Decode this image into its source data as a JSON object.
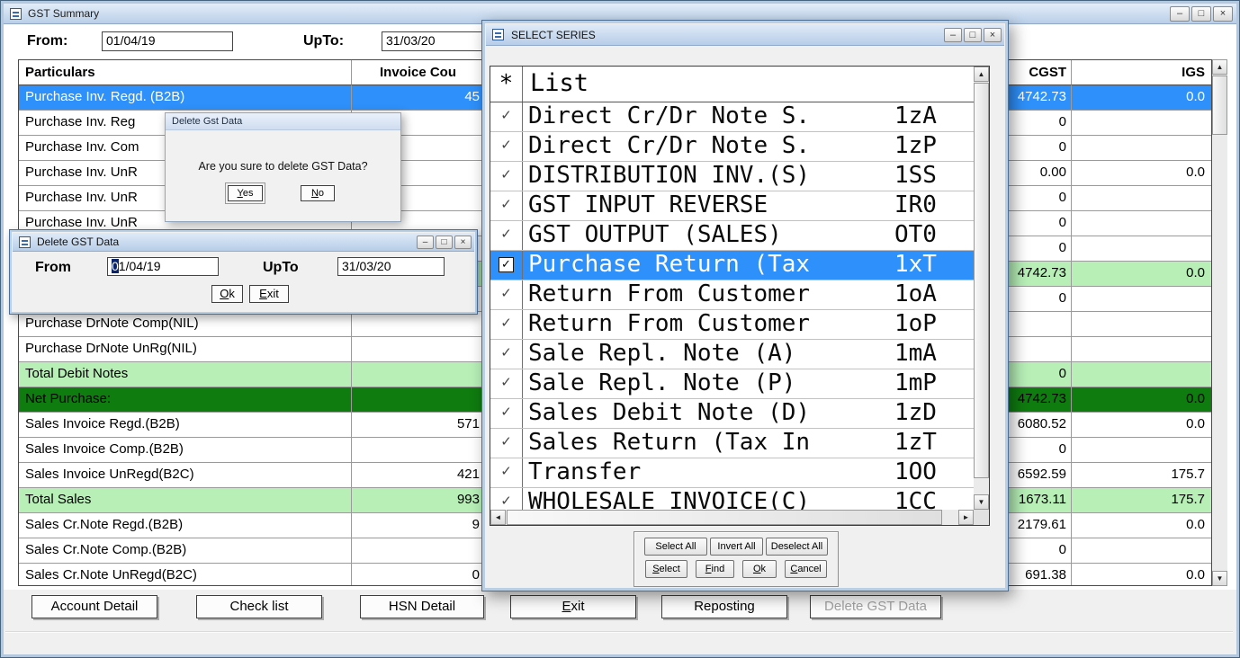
{
  "icons": {
    "scroll_up": "▲",
    "scroll_down": "▼",
    "scroll_left": "◄",
    "scroll_right": "►",
    "check": "✓"
  },
  "colors": {
    "selected_row": "#2e90fa",
    "total_row": "#b7efb7",
    "net_row": "#0f7c0f",
    "titlebar": "#b9cfe8",
    "selection_block": "#0a246a"
  },
  "main_window": {
    "title": "GST Summary",
    "controls": {
      "minimize": "–",
      "maximize": "□",
      "close": "×"
    },
    "filter": {
      "from_label": "From:",
      "from_value": "01/04/19",
      "upto_label": "UpTo:",
      "upto_value": "31/03/20"
    },
    "table": {
      "headers": {
        "particulars": "Particulars",
        "invoice_count": "Invoice Cou",
        "cgst": "CGST",
        "igst": "IGS"
      },
      "rows": [
        {
          "name": "Purchase Inv. Regd. (B2B)",
          "count": "45",
          "cgst": "4742.73",
          "igst": "0.0",
          "style": "selected"
        },
        {
          "name": "Purchase Inv. Reg",
          "count": "",
          "cgst": "0",
          "igst": "",
          "style": "normal"
        },
        {
          "name": "Purchase Inv. Com",
          "count": "",
          "cgst": "0",
          "igst": "",
          "style": "normal"
        },
        {
          "name": "Purchase Inv. UnR",
          "count": "",
          "cgst": "0.00",
          "igst": "0.0",
          "style": "normal"
        },
        {
          "name": "Purchase Inv. UnR",
          "count": "",
          "cgst": "0",
          "igst": "",
          "style": "normal"
        },
        {
          "name": "Purchase Inv. UnR",
          "count": "",
          "cgst": "0",
          "igst": "",
          "style": "normal"
        },
        {
          "name": "",
          "count": "",
          "cgst": "0",
          "igst": "",
          "style": "normal"
        },
        {
          "name": "",
          "count": "",
          "cgst": "4742.73",
          "igst": "0.0",
          "style": "total"
        },
        {
          "name": "",
          "count": "",
          "cgst": "0",
          "igst": "",
          "style": "normal"
        },
        {
          "name": "Purchase DrNote Comp(NIL)",
          "count": "",
          "cgst": "",
          "igst": "",
          "style": "normal"
        },
        {
          "name": "Purchase DrNote UnRg(NIL)",
          "count": "",
          "cgst": "",
          "igst": "",
          "style": "normal"
        },
        {
          "name": "Total Debit Notes",
          "count": "",
          "cgst": "0",
          "igst": "",
          "style": "total"
        },
        {
          "name": "Net Purchase:",
          "count": "",
          "cgst": "4742.73",
          "igst": "0.0",
          "style": "net"
        },
        {
          "name": "Sales Invoice Regd.(B2B)",
          "count": "571",
          "cgst": "6080.52",
          "igst": "0.0",
          "style": "normal"
        },
        {
          "name": "Sales Invoice Comp.(B2B)",
          "count": "",
          "cgst": "0",
          "igst": "",
          "style": "normal"
        },
        {
          "name": "Sales Invoice UnRegd(B2C)",
          "count": "421",
          "cgst": "6592.59",
          "igst": "175.7",
          "style": "normal"
        },
        {
          "name": "Total Sales",
          "count": "993",
          "cgst": "1673.11",
          "igst": "175.7",
          "style": "total"
        },
        {
          "name": "Sales Cr.Note Regd.(B2B)",
          "count": "9",
          "cgst": "2179.61",
          "igst": "0.0",
          "style": "normal"
        },
        {
          "name": "Sales Cr.Note Comp.(B2B)",
          "count": "",
          "cgst": "0",
          "igst": "",
          "style": "normal"
        },
        {
          "name": "Sales Cr.Note UnRegd(B2C)",
          "count": "0",
          "cgst": "691.38",
          "igst": "0.0",
          "style": "normal"
        }
      ]
    },
    "footer_buttons": [
      {
        "label": "Account Detail",
        "disabled": false,
        "mn": false
      },
      {
        "label": "Check list",
        "disabled": false,
        "mn": false
      },
      {
        "label": "HSN Detail",
        "disabled": false,
        "mn": false
      },
      {
        "label": "Exit",
        "disabled": false,
        "mn": true
      },
      {
        "label": "Reposting",
        "disabled": false,
        "mn": false
      },
      {
        "label": "Delete GST Data",
        "disabled": true,
        "mn": false
      }
    ]
  },
  "confirm_dialog": {
    "title": "Delete Gst Data",
    "message": "Are you sure to delete GST Data?",
    "yes_label": "Yes",
    "no_label": "No"
  },
  "delete_dialog": {
    "title": "Delete GST Data",
    "controls": {
      "minimize": "–",
      "maximize": "□",
      "close": "×"
    },
    "from_label": "From",
    "from_value": "01/04/19",
    "upto_label": "UpTo",
    "upto_value": "31/03/20",
    "ok_label": "Ok",
    "exit_label": "Exit"
  },
  "select_series": {
    "title": "SELECT SERIES",
    "controls": {
      "minimize": "–",
      "maximize": "□",
      "close": "×"
    },
    "header": {
      "star": "*",
      "list": "List"
    },
    "items": [
      {
        "name": "Direct Cr/Dr Note S.",
        "code": "1zA",
        "checked": true,
        "selected": false
      },
      {
        "name": "Direct Cr/Dr Note S.",
        "code": "1zP",
        "checked": true,
        "selected": false
      },
      {
        "name": "DISTRIBUTION INV.(S)",
        "code": "1SS",
        "checked": true,
        "selected": false
      },
      {
        "name": "GST INPUT REVERSE",
        "code": "IR0",
        "checked": true,
        "selected": false
      },
      {
        "name": "GST OUTPUT (SALES)",
        "code": "OT0",
        "checked": true,
        "selected": false
      },
      {
        "name": "Purchase Return (Tax",
        "code": "1xT",
        "checked": true,
        "selected": true
      },
      {
        "name": "Return From Customer",
        "code": "1oA",
        "checked": true,
        "selected": false
      },
      {
        "name": "Return From Customer",
        "code": "1oP",
        "checked": true,
        "selected": false
      },
      {
        "name": "Sale Repl. Note (A)",
        "code": "1mA",
        "checked": true,
        "selected": false
      },
      {
        "name": "Sale Repl. Note (P)",
        "code": "1mP",
        "checked": true,
        "selected": false
      },
      {
        "name": "Sales Debit Note (D)",
        "code": "1zD",
        "checked": true,
        "selected": false
      },
      {
        "name": "Sales Return (Tax In",
        "code": "1zT",
        "checked": true,
        "selected": false
      },
      {
        "name": "Transfer",
        "code": "1OO",
        "checked": true,
        "selected": false
      },
      {
        "name": "WHOLESALE INVOICE(C)",
        "code": "1CC",
        "checked": true,
        "selected": false
      }
    ],
    "buttons_row1": [
      {
        "label": "Select All"
      },
      {
        "label": "Invert All"
      },
      {
        "label": "Deselect All"
      }
    ],
    "buttons_row2": [
      {
        "label": "Select"
      },
      {
        "label": "Find"
      },
      {
        "label": "Ok"
      },
      {
        "label": "Cancel"
      }
    ]
  }
}
